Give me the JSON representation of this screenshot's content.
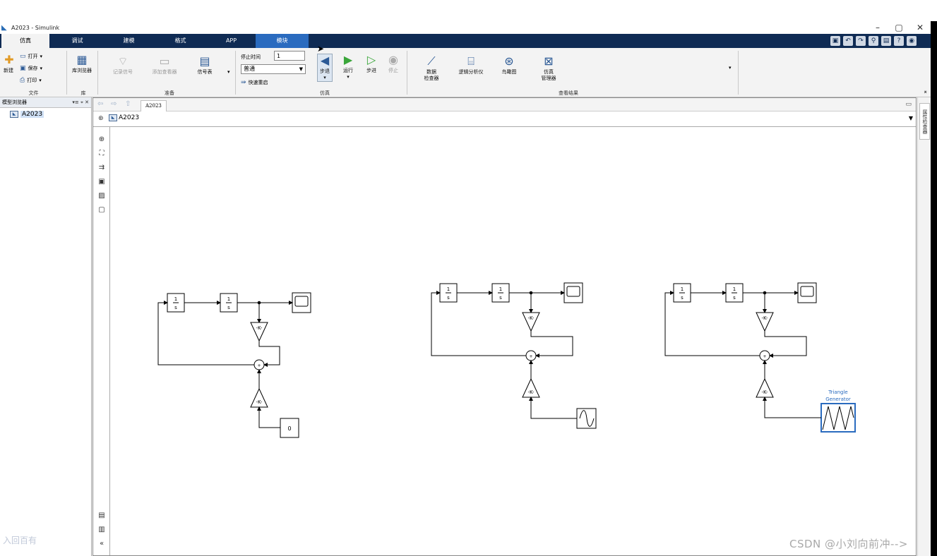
{
  "window": {
    "title": "A2023 - Simulink",
    "controls": [
      "–",
      "▢",
      "✕"
    ]
  },
  "tabs": [
    "仿真",
    "调试",
    "建模",
    "格式",
    "APP",
    "模块"
  ],
  "ribbon": {
    "file": {
      "new_label": "新建",
      "open_label": "打开",
      "save_label": "保存",
      "print_label": "打印",
      "group_label": "文件"
    },
    "library": {
      "browser_label": "库浏览器",
      "group_label": "库"
    },
    "prepare": {
      "log_signal_label": "记录信号",
      "add_viewer_label": "添加查看器",
      "signal_table_label": "信号表",
      "group_label": "准备"
    },
    "simulate": {
      "stop_time_label": "停止时间",
      "stop_time_value": "1",
      "mode_value": "普通",
      "fast_restart_label": "快速重启",
      "step_back_label": "步退",
      "run_label": "运行",
      "step_fwd_label": "步进",
      "stop_label": "停止",
      "group_label": "仿真"
    },
    "review": {
      "data_inspector_label1": "数据",
      "data_inspector_label2": "检查器",
      "logic_analyzer_label": "逻辑分析仪",
      "birds_eye_label": "鸟瞰图",
      "sim_manager_label1": "仿真",
      "sim_manager_label2": "管理器",
      "group_label": "查看结果"
    }
  },
  "sidebar": {
    "title": "模型浏览器",
    "root": "A2023",
    "footer": "入回百有"
  },
  "canvas": {
    "tab": "A2023",
    "address": "A2023"
  },
  "right_panel": {
    "label": "属性检查器"
  },
  "blocks": {
    "integrator_num": "1",
    "integrator_den": "s",
    "gain": "-K-",
    "constant_value": "0",
    "triangle_label1": "Triangle",
    "triangle_label2": "Generator"
  },
  "watermark": "CSDN @小刘向前冲-->",
  "colors": {
    "tabbar_bg": "#0f2b54",
    "active_tab": "#2a6bbf",
    "triangle_accent": "#2a6bbf",
    "run_green": "#3aa63a"
  }
}
